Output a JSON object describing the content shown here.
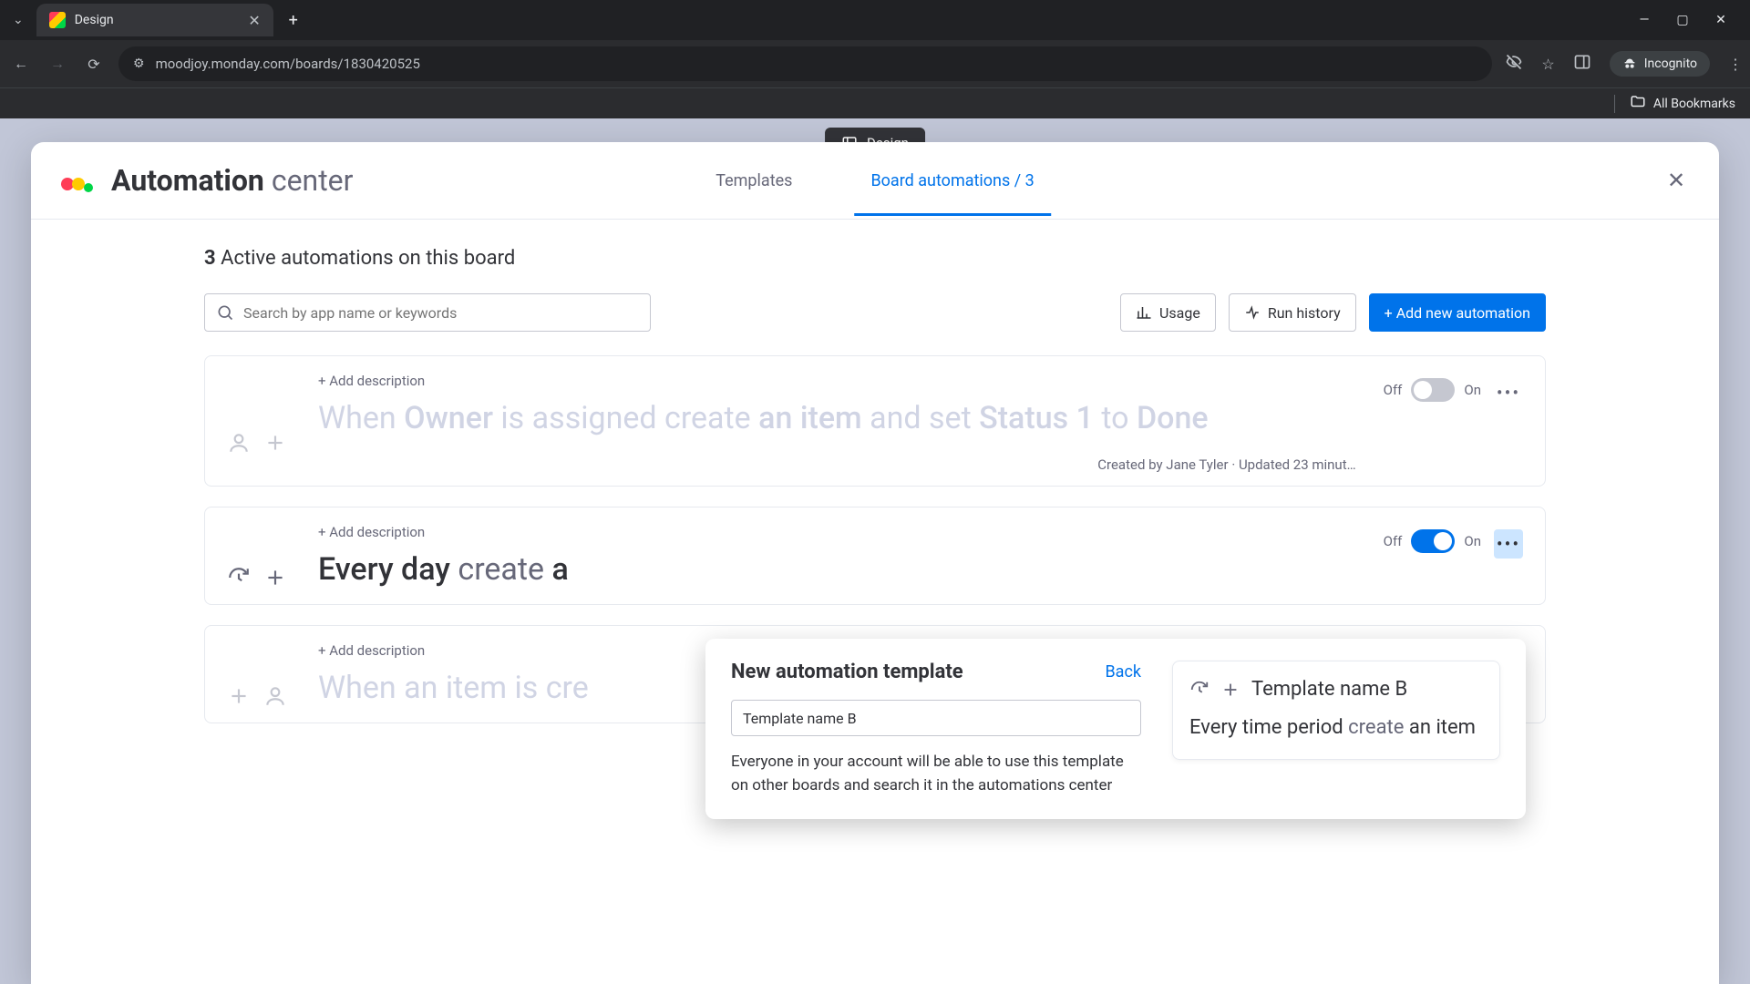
{
  "browser": {
    "tab_title": "Design",
    "url": "moodjoy.monday.com/boards/1830420525",
    "incognito_label": "Incognito",
    "all_bookmarks": "All Bookmarks",
    "page_indicator": "Design"
  },
  "modal": {
    "title_bold": "Automation",
    "title_light": "center",
    "tabs": {
      "templates": "Templates",
      "board_automations": "Board automations / 3"
    }
  },
  "summary": {
    "count": "3",
    "label": "Active automations on this board"
  },
  "controls": {
    "search_placeholder": "Search by app name or keywords",
    "usage": "Usage",
    "run_history": "Run history",
    "add_new": "+ Add new automation"
  },
  "common": {
    "add_description": "+ Add description",
    "off": "Off",
    "on": "On"
  },
  "card1": {
    "w1": "When",
    "w2": "Owner",
    "w3": "is assigned create",
    "w4": "an item",
    "w5": "and set",
    "w6": "Status 1",
    "w7": "to",
    "w8": "Done",
    "meta": "Created by Jane Tyler · Updated 23 minut…"
  },
  "card2": {
    "w1": "Every day",
    "w2": "create",
    "w3": "a"
  },
  "card3": {
    "w1": "When an item is cre"
  },
  "popover": {
    "title": "New automation template",
    "back": "Back",
    "input_value": "Template name B",
    "description": "Everyone in your account will be able to use this template on other boards and search it in the automations center",
    "preview_name": "Template name B",
    "preview_w1": "Every time period",
    "preview_w2": "create",
    "preview_w3": "an item"
  }
}
